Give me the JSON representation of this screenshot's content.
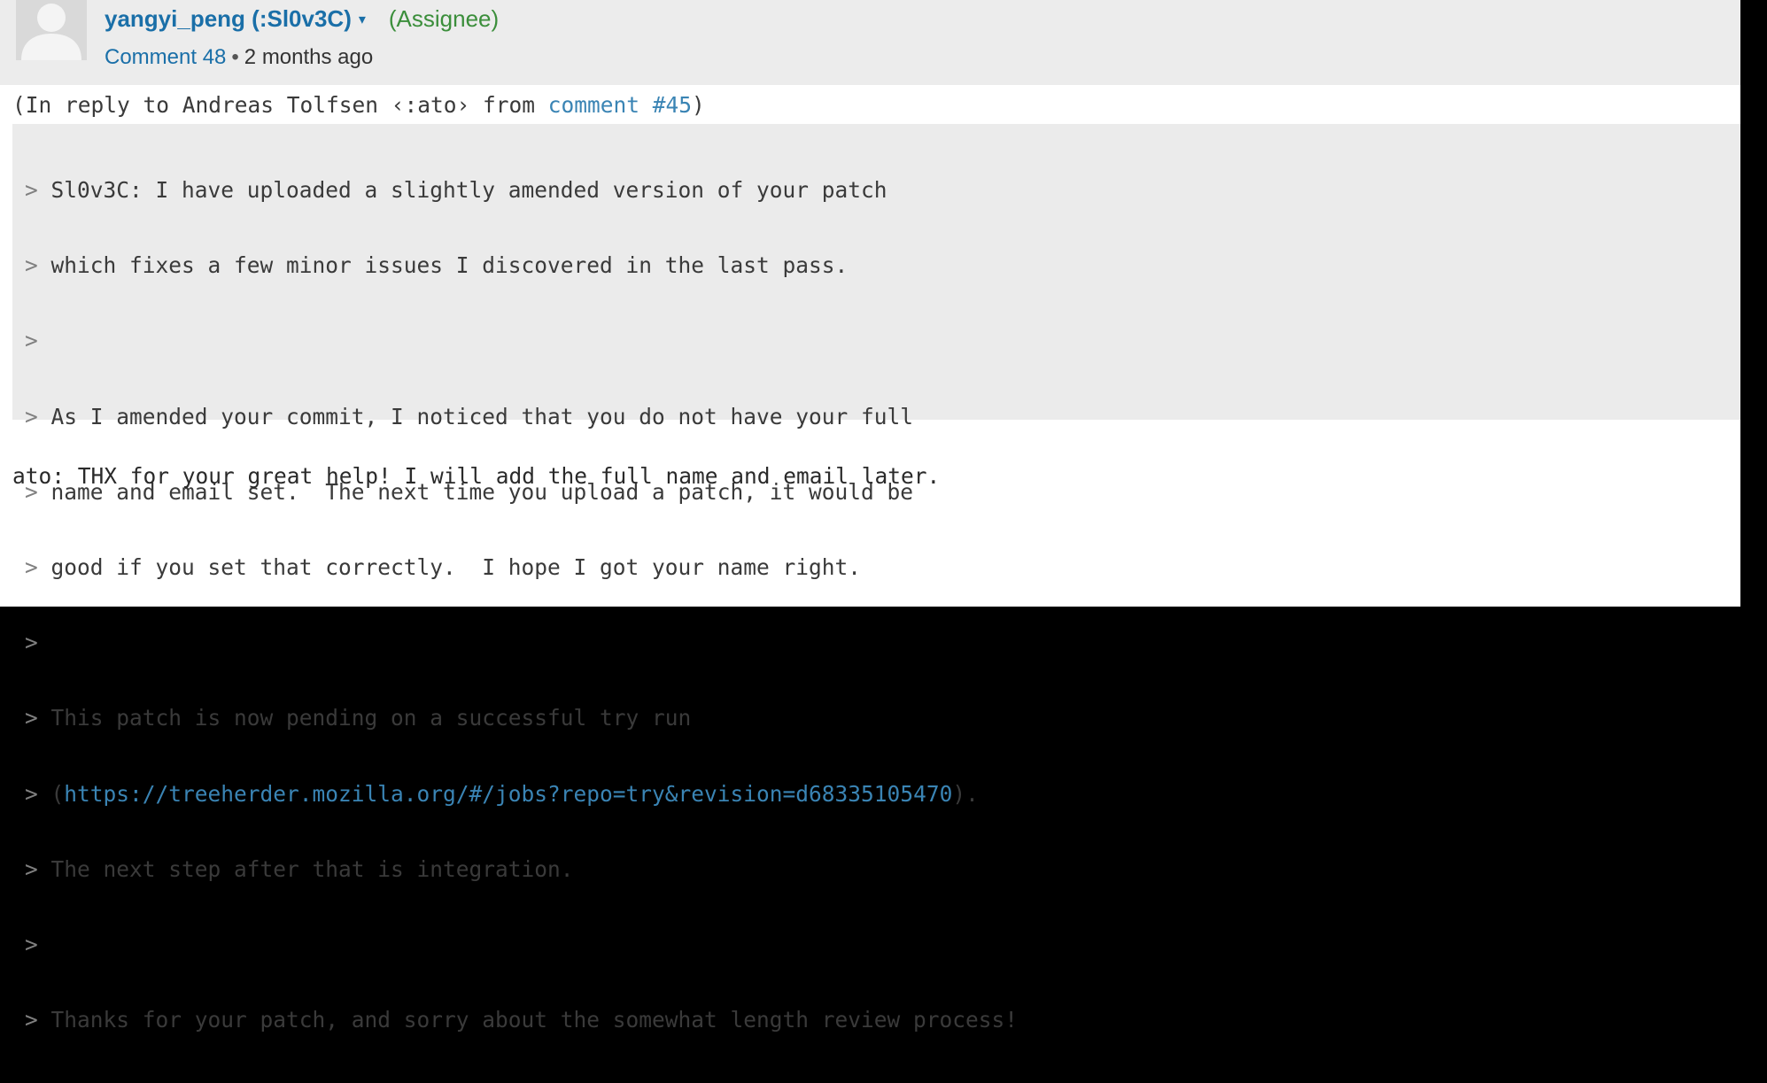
{
  "comment": {
    "author": "yangyi_peng (:Sl0v3C)",
    "author_caret": "▾",
    "role": "(Assignee)",
    "comment_label": "Comment 48",
    "separator": "•",
    "time_ago": "2 months ago",
    "reply_prefix": "(In reply to Andreas Tolfsen ‹:ato› from ",
    "reply_link": "comment #45",
    "reply_suffix": ")",
    "quote_marker": ">",
    "quote_lines": [
      "Sl0v3C: I have uploaded a slightly amended version of your patch",
      "which fixes a few minor issues I discovered in the last pass.",
      "",
      "As I amended your commit, I noticed that you do not have your full",
      "name and email set.  The next time you upload a patch, it would be",
      "good if you set that correctly.  I hope I got your name right.",
      "",
      "This patch is now pending on a successful try run",
      "",
      "The next step after that is integration.",
      "",
      "Thanks for your patch, and sorry about the somewhat length review process!"
    ],
    "quote_link_line": {
      "prefix": "(",
      "link": "https://treeherder.mozilla.org/#/jobs?repo=try&revision=d68335105470",
      "suffix": ")."
    },
    "body": "ato: THX for your great help! I will add the full name and email later."
  },
  "colors": {
    "link": "#1a6fa8",
    "assignee": "#3b8e3b",
    "header_bg": "#ececec",
    "quote_bg": "#ebebeb"
  },
  "icons": {
    "avatar": "default-user-avatar-icon",
    "caret": "chevron-down-icon"
  }
}
